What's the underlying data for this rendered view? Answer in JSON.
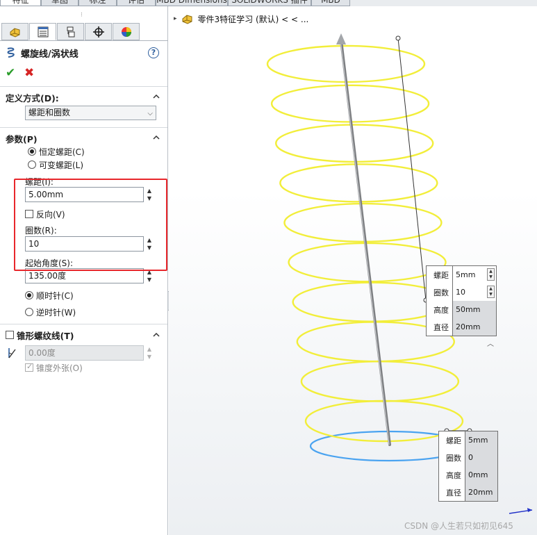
{
  "top_tabs": [
    {
      "label": "特征"
    },
    {
      "label": "草图"
    },
    {
      "label": "标注"
    },
    {
      "label": "评估"
    },
    {
      "label": "MBD Dimensions"
    },
    {
      "label": "SOLIDWORKS 插件"
    },
    {
      "label": "MBD"
    }
  ],
  "property_manager": {
    "grip": "⁝",
    "tab_icons": [
      "feature-manager-icon",
      "property-manager-icon",
      "configuration-manager-icon",
      "dimxpert-icon",
      "appearance-icon"
    ],
    "title": "螺旋线/涡状线",
    "help_glyph": "?",
    "ok_glyph": "✔",
    "cancel_glyph": "✖",
    "definition": {
      "heading": "定义方式(D):",
      "selected": "螺距和圈数"
    },
    "parameters": {
      "heading": "参数(P)",
      "pitch_mode_options": [
        {
          "label": "恒定螺距(C)",
          "selected": true
        },
        {
          "label": "可变螺距(L)",
          "selected": false
        }
      ],
      "pitch_label": "螺距(I):",
      "pitch_value": "5.00mm",
      "reverse_label": "反向(V)",
      "reverse_checked": false,
      "revolutions_label": "圈数(R):",
      "revolutions_value": "10",
      "start_angle_label": "起始角度(S):",
      "start_angle_value": "135.00度",
      "direction_options": [
        {
          "label": "顺时针(C)",
          "selected": true
        },
        {
          "label": "逆时针(W)",
          "selected": false
        }
      ]
    },
    "taper": {
      "heading": "锥形螺纹线(T)",
      "checked": false,
      "angle_value": "0.00度",
      "taper_outward_label": "锥度外张(O)",
      "taper_outward_checked": true
    }
  },
  "feature_tree": {
    "expand_glyph": "▸",
    "part_label": "零件3特征学习 (默认) < < ..."
  },
  "callout_top": {
    "rows": [
      {
        "key": "螺距",
        "value": "5mm"
      },
      {
        "key": "圈数",
        "value": "10"
      },
      {
        "key": "高度",
        "value": "50mm"
      },
      {
        "key": "直径",
        "value": "20mm"
      }
    ]
  },
  "callout_bottom": {
    "rows": [
      {
        "key": "螺距",
        "value": "5mm"
      },
      {
        "key": "圈数",
        "value": "0"
      },
      {
        "key": "高度",
        "value": "0mm"
      },
      {
        "key": "直径",
        "value": "20mm"
      }
    ]
  },
  "colors": {
    "helix": "#f2ee3a",
    "start_ring": "#4aa3f0",
    "highlight_box": "#e8262b"
  },
  "watermark": "CSDN @人生若只如初见645"
}
